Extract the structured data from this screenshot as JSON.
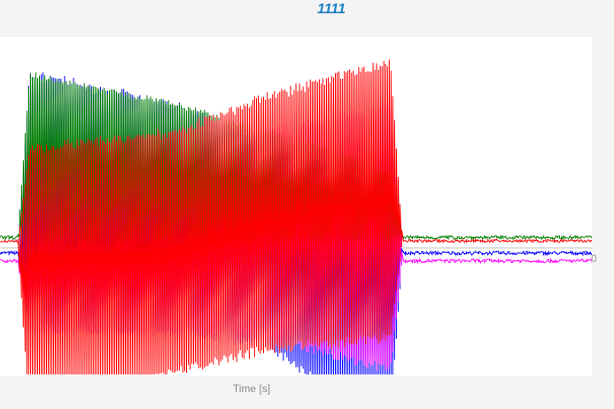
{
  "chart_data": {
    "type": "line",
    "title": "1111",
    "xlabel": "Time [s]",
    "ylabel": "",
    "zero_tick_label": "0",
    "ylim": [
      -1.0,
      1.0
    ],
    "xlim": [
      0,
      1
    ],
    "grid": false,
    "legend": "none",
    "series": [
      {
        "color": "#0000ff",
        "offset": -0.03,
        "noise": 0.01,
        "x": [
          0.0,
          0.03,
          0.05,
          0.3,
          0.45,
          0.6,
          0.66,
          0.68,
          1.0
        ],
        "upper": [
          0.0,
          0.0,
          1.0,
          0.82,
          0.62,
          0.42,
          0.3,
          0.0,
          0.0
        ],
        "lower": [
          0.0,
          0.0,
          -0.4,
          -0.45,
          -0.5,
          -0.88,
          -0.92,
          0.0,
          0.0
        ]
      },
      {
        "color": "#ff00ff",
        "offset": -0.075,
        "noise": 0.01,
        "x": [
          0.0,
          0.03,
          0.05,
          0.3,
          0.45,
          0.6,
          0.66,
          0.68,
          1.0
        ],
        "upper": [
          0.0,
          0.0,
          0.2,
          0.3,
          0.72,
          0.82,
          0.88,
          0.0,
          0.0
        ],
        "lower": [
          0.0,
          0.0,
          -0.4,
          -0.4,
          -0.42,
          -0.55,
          -0.6,
          0.0,
          0.0
        ]
      },
      {
        "color": "#008000",
        "offset": 0.06,
        "noise": 0.01,
        "x": [
          0.0,
          0.03,
          0.05,
          0.3,
          0.45,
          0.6,
          0.66,
          0.68,
          1.0
        ],
        "upper": [
          0.0,
          0.0,
          0.92,
          0.75,
          0.6,
          0.45,
          0.35,
          0.0,
          0.0
        ],
        "lower": [
          0.0,
          0.0,
          0.0,
          0.0,
          0.0,
          0.0,
          0.0,
          0.0,
          0.0
        ]
      },
      {
        "color": "#ff0000",
        "offset": 0.04,
        "noise": 0.008,
        "x": [
          0.0,
          0.03,
          0.05,
          0.3,
          0.45,
          0.6,
          0.66,
          0.68,
          1.0
        ],
        "upper": [
          0.0,
          0.0,
          0.5,
          0.6,
          0.8,
          0.95,
          1.0,
          0.0,
          0.0
        ],
        "lower": [
          0.0,
          0.0,
          -1.0,
          -0.72,
          -0.6,
          -0.55,
          -0.52,
          0.0,
          0.0
        ]
      }
    ]
  }
}
